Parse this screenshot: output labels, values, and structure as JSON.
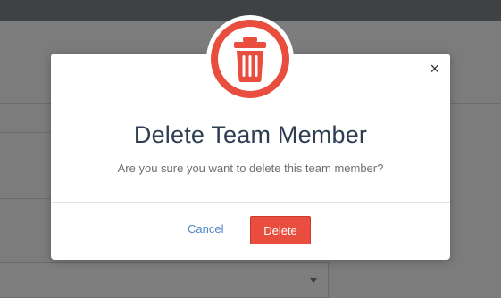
{
  "modal": {
    "icon": "trash-icon",
    "close_symbol": "×",
    "title": "Delete Team Member",
    "message": "Are you sure you want to delete this team member?",
    "cancel_label": "Cancel",
    "delete_label": "Delete"
  },
  "colors": {
    "danger": "#e84d3d",
    "title": "#2e3d52",
    "link": "#4f86c6",
    "overlay": "#7a7a7a",
    "topbar": "#3e4245"
  }
}
